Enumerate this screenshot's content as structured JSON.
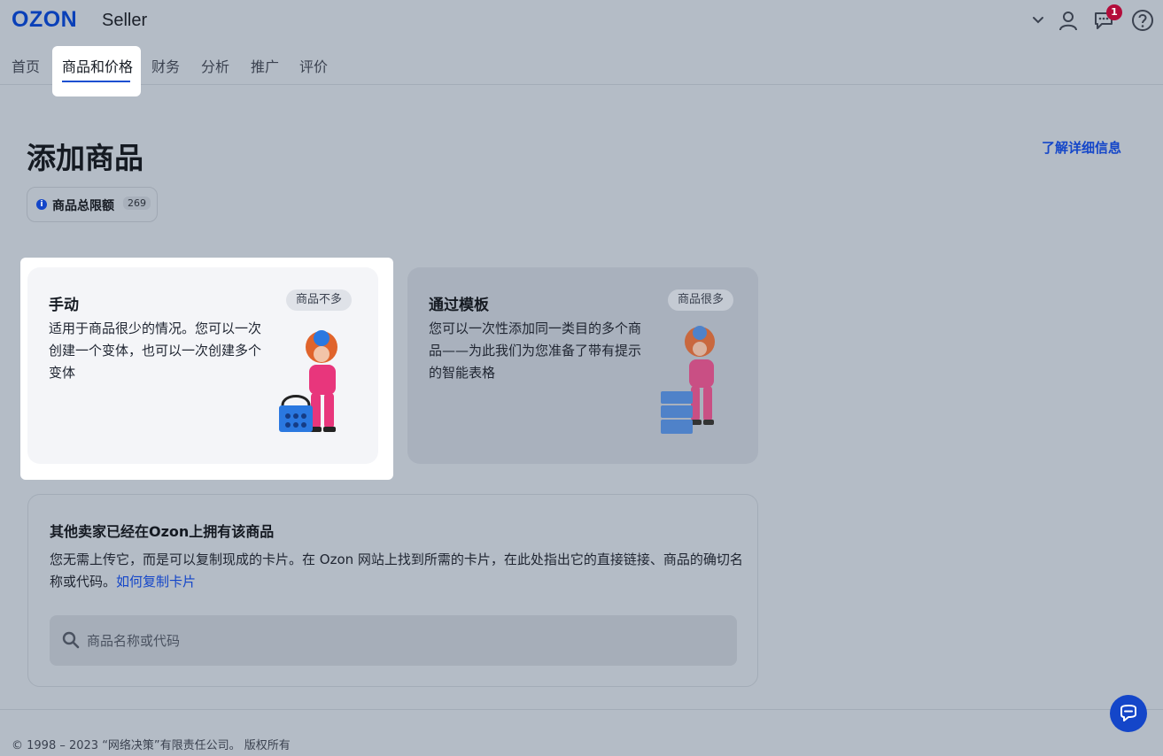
{
  "header": {
    "logo": "OZON",
    "logo_sub": "Seller",
    "notification_count": "1",
    "icons": [
      "chevron-down-icon",
      "user-icon",
      "chat-icon",
      "help-icon"
    ]
  },
  "nav": {
    "items": [
      "首页",
      "商品和价格",
      "财务",
      "分析",
      "推广",
      "评价"
    ],
    "active_index": 1
  },
  "page": {
    "title": "添加商品",
    "more_link": "了解详细信息",
    "limit_label": "商品总限额",
    "limit_count": "269"
  },
  "cards": [
    {
      "title": "手动",
      "tag": "商品不多",
      "description": "适用于商品很少的情况。您可以一次创建一个变体，也可以一次创建多个变体"
    },
    {
      "title": "通过模板",
      "tag": "商品很多",
      "description": "您可以一次性添加同一类目的多个商品——为此我们为您准备了带有提示的智能表格"
    }
  ],
  "other_sellers": {
    "title": "其他卖家已经在Ozon上拥有该商品",
    "description": "您无需上传它，而是可以复制现成的卡片。在 Ozon 网站上找到所需的卡片，在此处指出它的直接链接、商品的确切名称或代码。",
    "link": "如何复制卡片",
    "search_placeholder": "商品名称或代码"
  },
  "footer": {
    "text": "© 1998 – 2023 “网络决策”有限责任公司。 版权所有"
  },
  "colors": {
    "accent": "#1446c9",
    "badge": "#b30c3b",
    "overlay_bg": "#b4bcc6"
  }
}
